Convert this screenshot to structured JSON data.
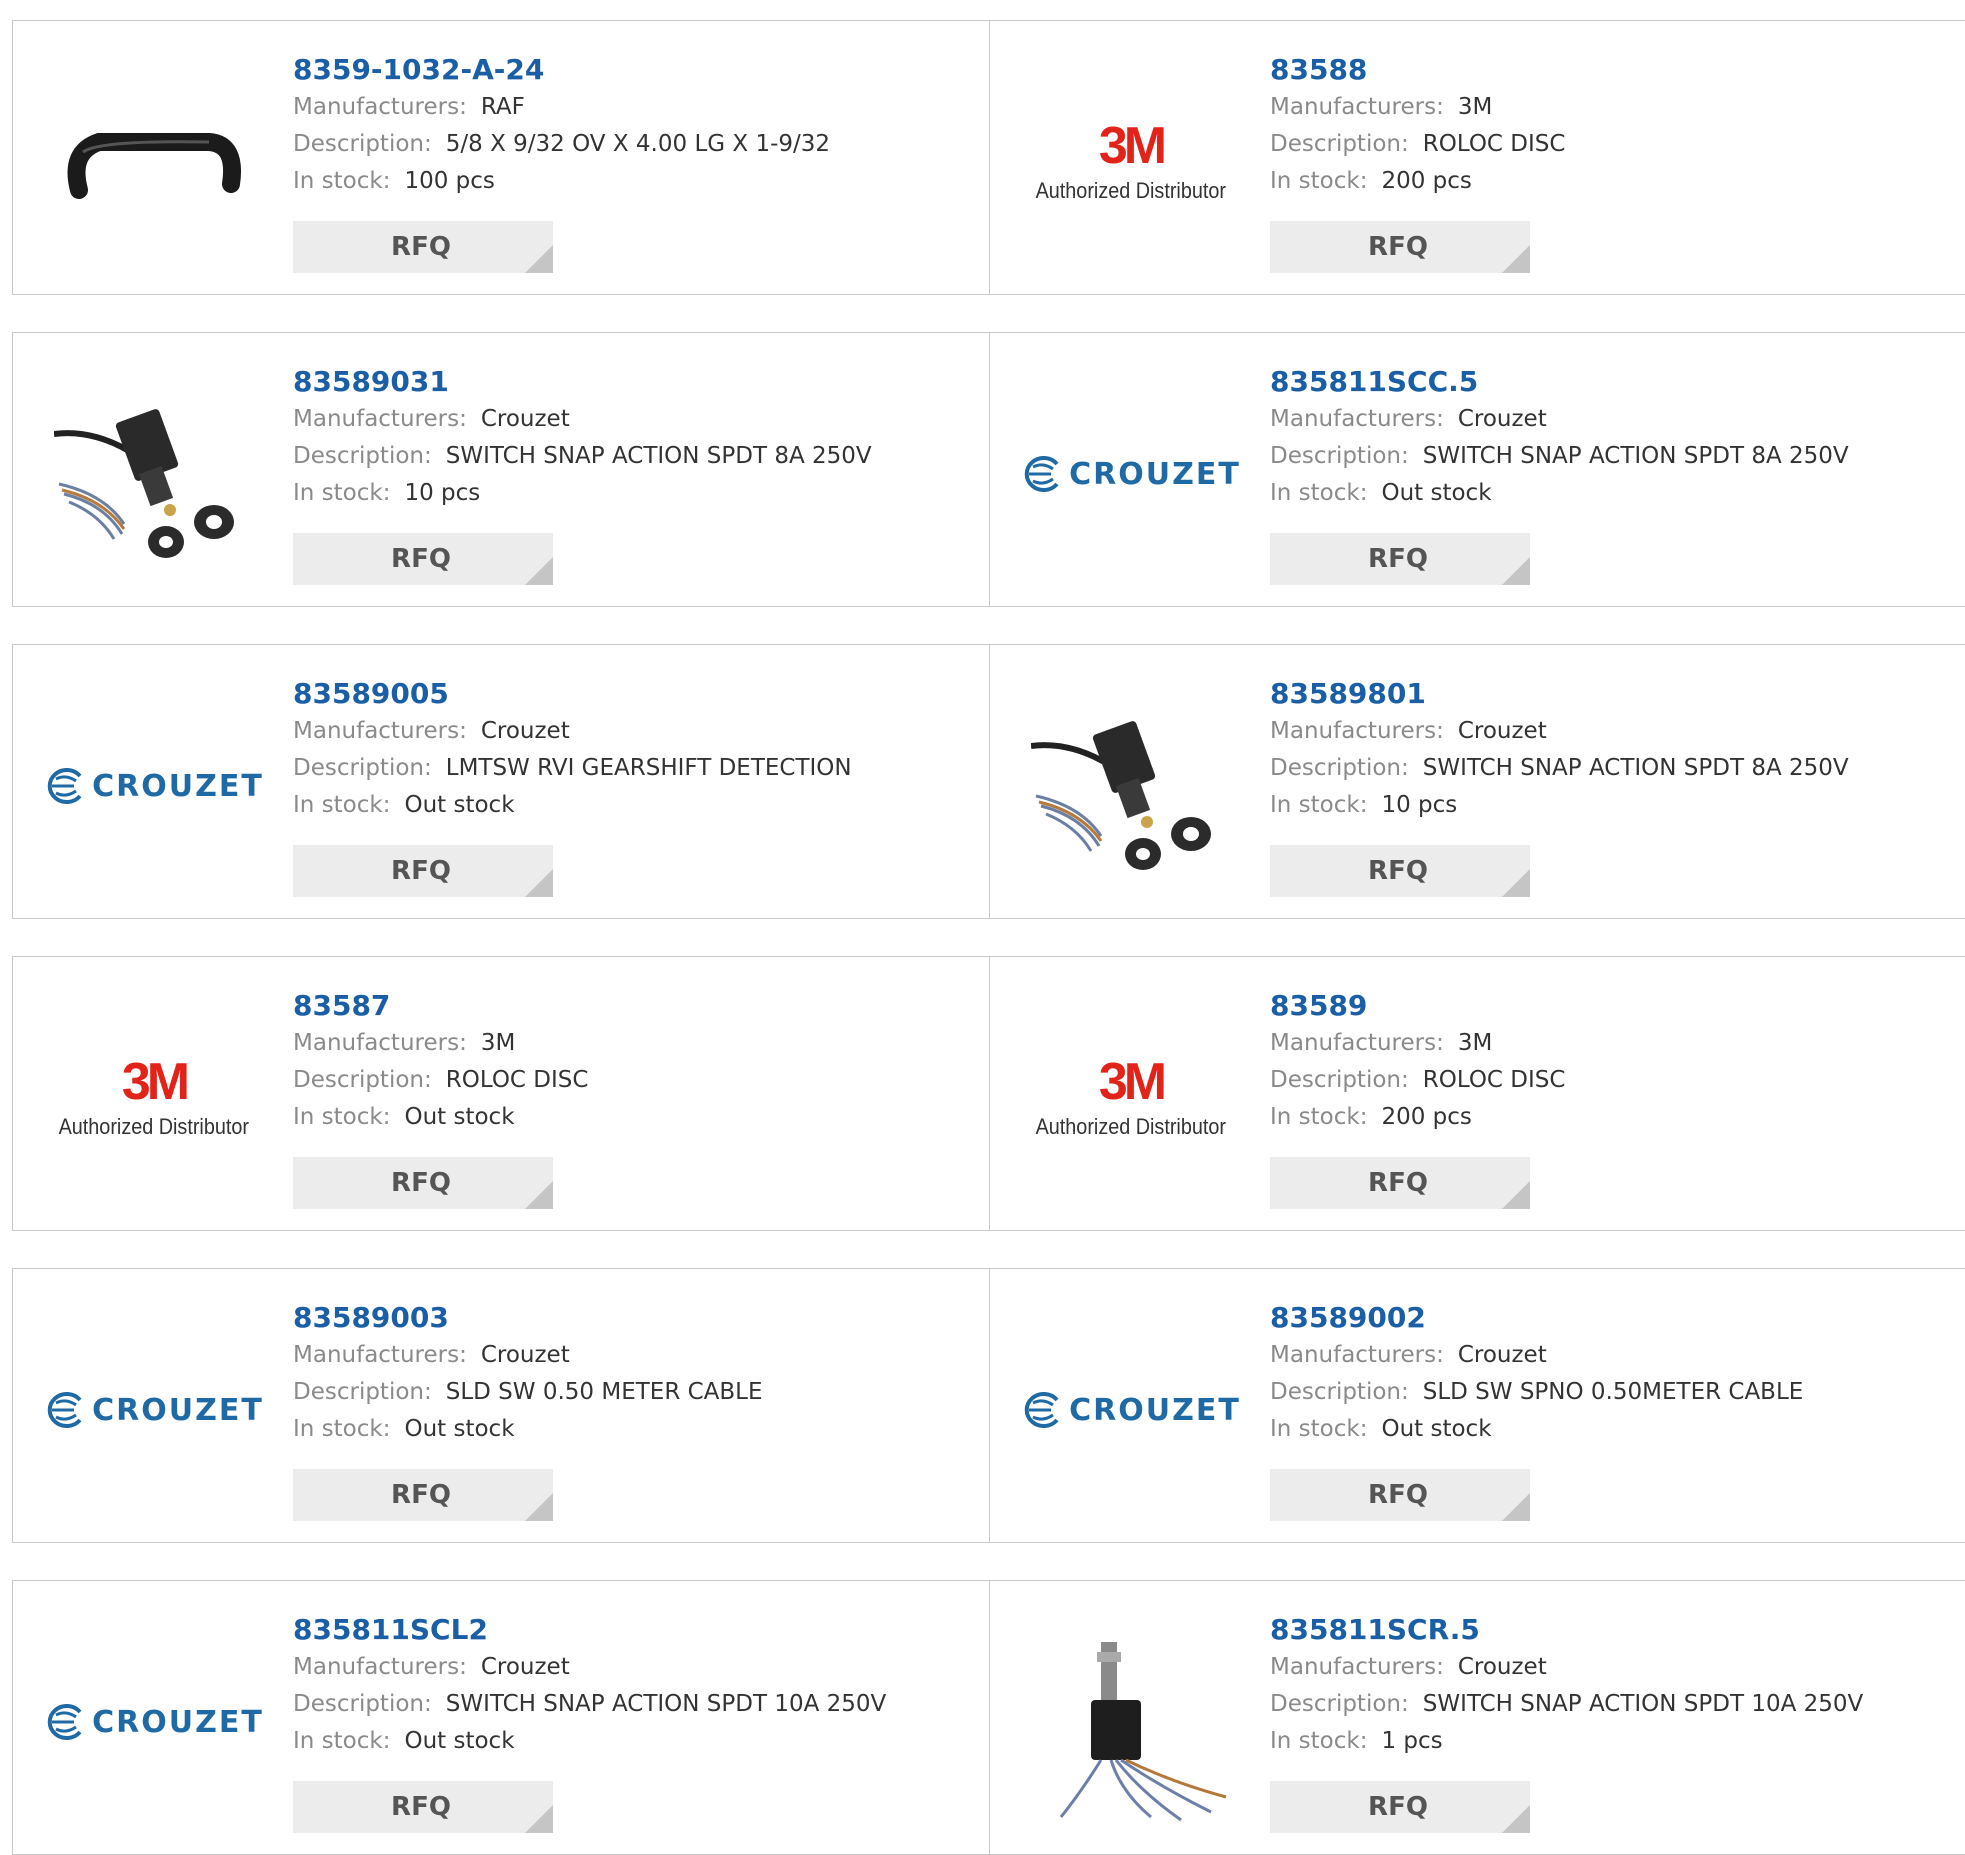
{
  "labels": {
    "manufacturers": "Manufacturers:",
    "description": "Description:",
    "in_stock": "In stock:",
    "rfq": "RFQ"
  },
  "logos": {
    "threem_big": "3M",
    "threem_sub": "Authorized Distributor",
    "crouzet": "CROUZET"
  },
  "colors": {
    "part_link": "#1a5fa6",
    "threem_red": "#e2231a",
    "crouzet_blue": "#1f6aa5",
    "rfq_bg": "#ececec"
  },
  "products": [
    {
      "part": "8359-1032-A-24",
      "manufacturer": "RAF",
      "description": "5/8 X 9/32 OV X 4.00 LG X 1-9/32",
      "stock": "100 pcs",
      "image": "handle"
    },
    {
      "part": "83588",
      "manufacturer": "3M",
      "description": "ROLOC DISC",
      "stock": "200 pcs",
      "image": "3m"
    },
    {
      "part": "83589031",
      "manufacturer": "Crouzet",
      "description": "SWITCH SNAP ACTION SPDT 8A 250V",
      "stock": "10 pcs",
      "image": "switch-cable"
    },
    {
      "part": "835811SCC.5",
      "manufacturer": "Crouzet",
      "description": "SWITCH SNAP ACTION SPDT 8A 250V",
      "stock": "Out stock",
      "image": "crouzet"
    },
    {
      "part": "83589005",
      "manufacturer": "Crouzet",
      "description": "LMTSW RVI GEARSHIFT DETECTION",
      "stock": "Out stock",
      "image": "crouzet"
    },
    {
      "part": "83589801",
      "manufacturer": "Crouzet",
      "description": "SWITCH SNAP ACTION SPDT 8A 250V",
      "stock": "10 pcs",
      "image": "switch-cable"
    },
    {
      "part": "83587",
      "manufacturer": "3M",
      "description": "ROLOC DISC",
      "stock": "Out stock",
      "image": "3m"
    },
    {
      "part": "83589",
      "manufacturer": "3M",
      "description": "ROLOC DISC",
      "stock": "200 pcs",
      "image": "3m"
    },
    {
      "part": "83589003",
      "manufacturer": "Crouzet",
      "description": "SLD SW 0.50 METER CABLE",
      "stock": "Out stock",
      "image": "crouzet"
    },
    {
      "part": "83589002",
      "manufacturer": "Crouzet",
      "description": "SLD SW SPNO 0.50METER CABLE",
      "stock": "Out stock",
      "image": "crouzet"
    },
    {
      "part": "835811SCL2",
      "manufacturer": "Crouzet",
      "description": "SWITCH SNAP ACTION SPDT 10A 250V",
      "stock": "Out stock",
      "image": "crouzet"
    },
    {
      "part": "835811SCR.5",
      "manufacturer": "Crouzet",
      "description": "SWITCH SNAP ACTION SPDT 10A 250V",
      "stock": "1 pcs",
      "image": "plunger-switch"
    }
  ]
}
